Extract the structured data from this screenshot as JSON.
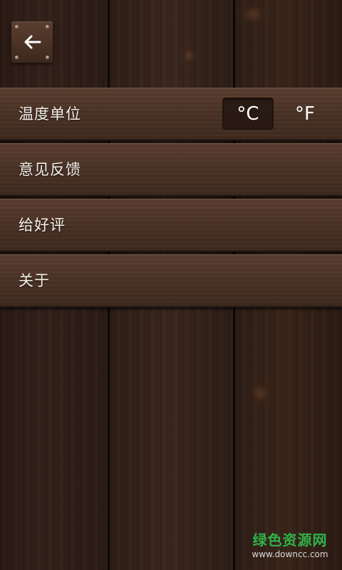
{
  "header": {
    "back_icon": "arrow-left-icon"
  },
  "settings": {
    "items": [
      {
        "label": "温度单位"
      },
      {
        "label": "意见反馈"
      },
      {
        "label": "给好评"
      },
      {
        "label": "关于"
      }
    ],
    "temperature_unit": {
      "options": [
        "°C",
        "°F"
      ],
      "selected": "°C"
    }
  },
  "watermark": {
    "text": "绿色资源网",
    "url": "www.downcc.com"
  },
  "colors": {
    "text": "#f4efe9",
    "watermark_green": "#2fb24a"
  }
}
